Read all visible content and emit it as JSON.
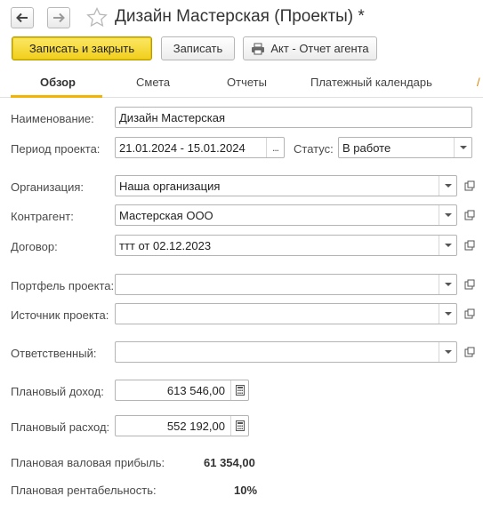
{
  "window": {
    "title": "Дизайн Мастерская (Проекты) *",
    "back_icon": "arrow-left-icon",
    "forward_icon": "arrow-right-icon",
    "favorite_icon": "star-icon"
  },
  "toolbar": {
    "save_close_label": "Записать и закрыть",
    "save_label": "Записать",
    "report_label": "Акт - Отчет агента",
    "report_icon": "printer-icon"
  },
  "tabs": [
    {
      "label": "Обзор",
      "active": true
    },
    {
      "label": "Смета",
      "active": false
    },
    {
      "label": "Отчеты",
      "active": false
    },
    {
      "label": "Платежный календарь",
      "active": false
    }
  ],
  "form": {
    "name_label": "Наименование:",
    "name_value": "Дизайн Мастерская",
    "period_label": "Период проекта:",
    "period_value": "21.01.2024 - 15.01.2024",
    "period_button": "...",
    "status_label": "Статус:",
    "status_value": "В работе",
    "organization_label": "Организация:",
    "organization_value": "Наша организация",
    "counterparty_label": "Контрагент:",
    "counterparty_value": "Мастерская ООО",
    "contract_label": "Договор:",
    "contract_value": "ттт от 02.12.2023",
    "portfolio_label": "Портфель проекта:",
    "portfolio_value": "",
    "source_label": "Источник проекта:",
    "source_value": "",
    "responsible_label": "Ответственный:",
    "responsible_value": "",
    "planned_income_label": "Плановый доход:",
    "planned_income_value": "613 546,00",
    "planned_expense_label": "Плановый расход:",
    "planned_expense_value": "552 192,00",
    "gross_profit_label": "Плановая валовая прибыль:",
    "gross_profit_value": "61 354,00",
    "profitability_label": "Плановая рентабельность:",
    "profitability_value": "10%"
  },
  "colors": {
    "accent": "#f2cf1a",
    "tab_underline": "#f2b400",
    "border": "#b4b4b4"
  }
}
